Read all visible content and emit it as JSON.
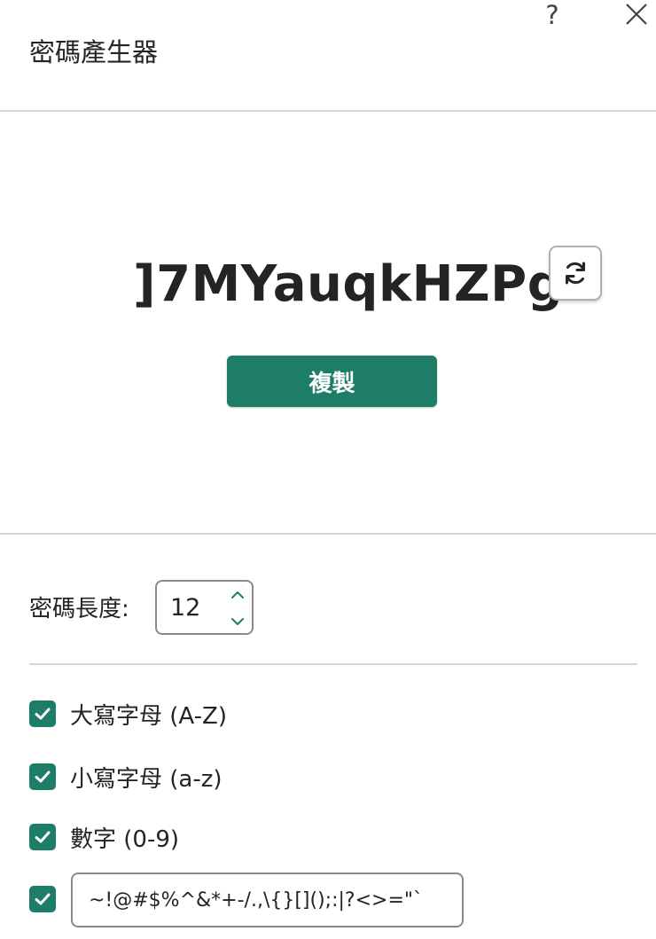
{
  "dialog": {
    "title": "密碼產生器",
    "help_label": "?"
  },
  "password": {
    "value": "]7MYauqkHZPg",
    "copy_label": "複製"
  },
  "length": {
    "label": "密碼長度:",
    "value": "12"
  },
  "options": [
    {
      "label": "大寫字母 (A-Z)",
      "checked": true
    },
    {
      "label": "小寫字母 (a-z)",
      "checked": true
    },
    {
      "label": "數字 (0-9)",
      "checked": true
    },
    {
      "label": "",
      "checked": true
    }
  ],
  "symbols": {
    "value": "~!@#$%^&*+-/.,\\{}[]();:|?<>=\"`"
  },
  "colors": {
    "accent": "#1e7d67",
    "divider": "#d6d6d6"
  }
}
